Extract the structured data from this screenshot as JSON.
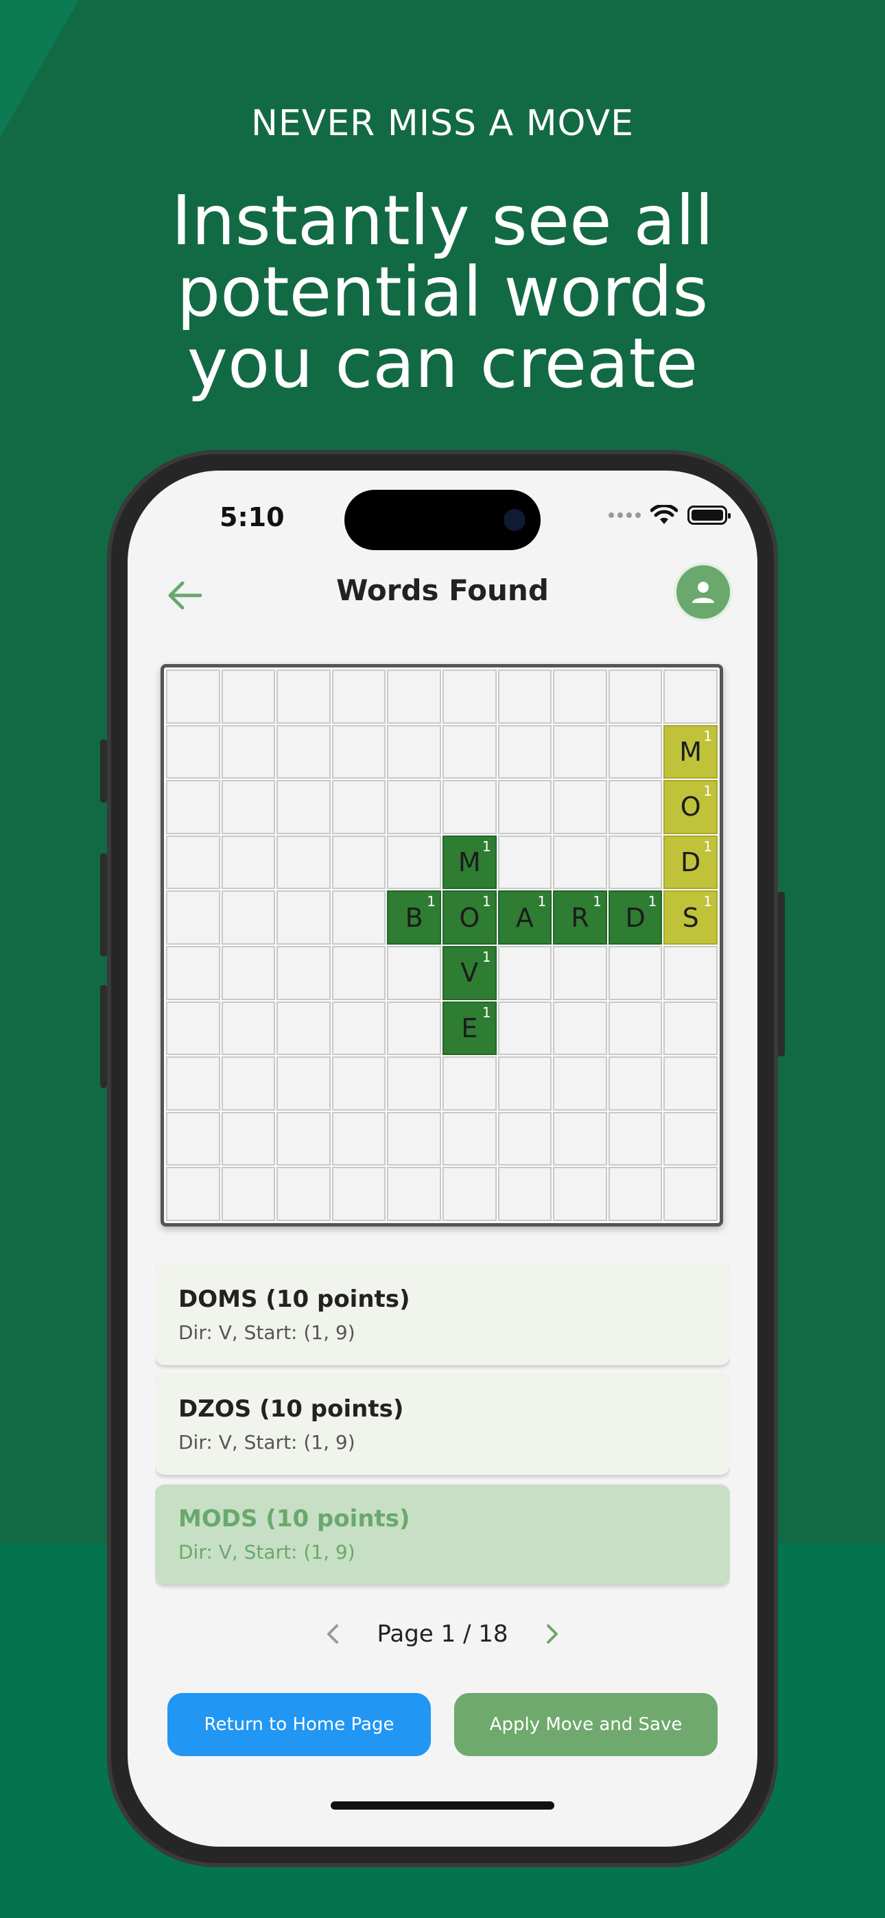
{
  "promo": {
    "kicker": "NEVER MISS A MOVE",
    "headline_lines": [
      "Instantly see all",
      "potential words",
      "you can create"
    ]
  },
  "status_bar": {
    "time": "5:10"
  },
  "header": {
    "title": "Words Found",
    "back_icon": "arrow-left-icon",
    "avatar_icon": "person-icon"
  },
  "board": {
    "rows": 10,
    "cols": 10,
    "tiles": [
      {
        "row": 2,
        "col": 10,
        "letter": "M",
        "points": "1",
        "color": "yellow"
      },
      {
        "row": 3,
        "col": 10,
        "letter": "O",
        "points": "1",
        "color": "yellow"
      },
      {
        "row": 4,
        "col": 10,
        "letter": "D",
        "points": "1",
        "color": "yellow"
      },
      {
        "row": 5,
        "col": 10,
        "letter": "S",
        "points": "1",
        "color": "yellow"
      },
      {
        "row": 4,
        "col": 6,
        "letter": "M",
        "points": "1",
        "color": "green"
      },
      {
        "row": 5,
        "col": 5,
        "letter": "B",
        "points": "1",
        "color": "green"
      },
      {
        "row": 5,
        "col": 6,
        "letter": "O",
        "points": "1",
        "color": "green"
      },
      {
        "row": 5,
        "col": 7,
        "letter": "A",
        "points": "1",
        "color": "green"
      },
      {
        "row": 5,
        "col": 8,
        "letter": "R",
        "points": "1",
        "color": "green"
      },
      {
        "row": 5,
        "col": 9,
        "letter": "D",
        "points": "1",
        "color": "green"
      },
      {
        "row": 6,
        "col": 6,
        "letter": "V",
        "points": "1",
        "color": "green"
      },
      {
        "row": 7,
        "col": 6,
        "letter": "E",
        "points": "1",
        "color": "green"
      }
    ]
  },
  "words": [
    {
      "title": "DOMS (10 points)",
      "detail": "Dir: V, Start: (1, 9)",
      "selected": false
    },
    {
      "title": "DZOS (10 points)",
      "detail": "Dir: V, Start: (1, 9)",
      "selected": false
    },
    {
      "title": "MODS (10 points)",
      "detail": "Dir: V, Start: (1, 9)",
      "selected": true
    }
  ],
  "pagination": {
    "label": "Page 1 / 18",
    "prev_icon": "chevron-left-icon",
    "next_icon": "chevron-right-icon"
  },
  "actions": {
    "home_label": "Return to Home Page",
    "apply_label": "Apply Move and Save"
  },
  "colors": {
    "background": "#126a44",
    "tile_green": "#2e7d32",
    "tile_yellow": "#c0c23a",
    "accent_green": "#6aa86d",
    "home_button": "#2196f3",
    "apply_button": "#6fa96d"
  }
}
